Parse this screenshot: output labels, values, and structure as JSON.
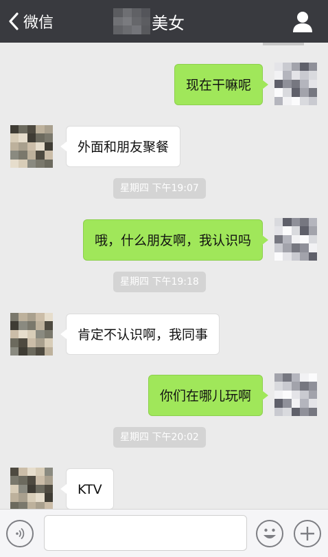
{
  "header": {
    "back_label": "微信",
    "title": "美女",
    "back_icon": "chevron-left-icon",
    "profile_icon": "person-icon"
  },
  "messages": [
    {
      "sender": "me",
      "text": "现在干嘛呢"
    },
    {
      "sender": "other",
      "text": "外面和朋友聚餐"
    },
    {
      "sender": "time",
      "text": "星期四 下午19:07"
    },
    {
      "sender": "me",
      "text": "哦，什么朋友啊，我认识吗"
    },
    {
      "sender": "time",
      "text": "星期四 下午19:18"
    },
    {
      "sender": "other",
      "text": "肯定不认识啊，我同事"
    },
    {
      "sender": "me",
      "text": "你们在哪儿玩啊"
    },
    {
      "sender": "time",
      "text": "星期四 下午20:02"
    },
    {
      "sender": "other",
      "text": "KTV"
    }
  ],
  "input_bar": {
    "input_value": "",
    "voice_icon": "voice-icon",
    "emoji_icon": "emoji-icon",
    "plus_icon": "plus-icon"
  },
  "colors": {
    "header_bg": "#393a3f",
    "chat_bg": "#ebebeb",
    "my_bubble": "#a0e75a",
    "their_bubble": "#ffffff",
    "timestamp_bg": "#d4d4d4"
  }
}
